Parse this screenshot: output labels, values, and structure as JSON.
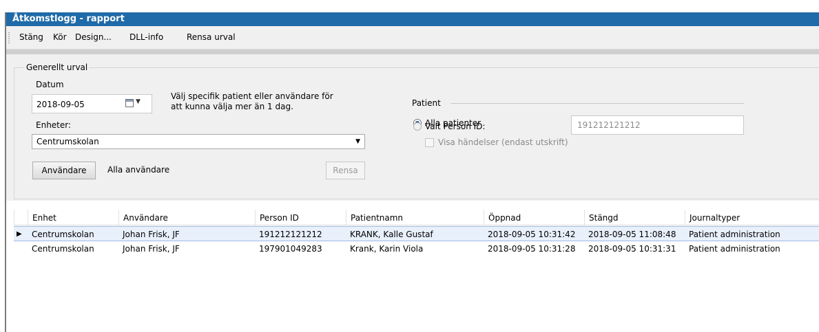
{
  "window": {
    "title": "Åtkomstlogg - rapport"
  },
  "menu": [
    {
      "label": "Stäng"
    },
    {
      "label": "Kör"
    },
    {
      "label": "Design..."
    },
    {
      "label": "DLL-info"
    },
    {
      "label": "Rensa urval"
    }
  ],
  "general": {
    "group_label": "Generellt urval",
    "date_label": "Datum",
    "date_value": "2018-09-05",
    "hint": [
      "Välj specifik patient eller användare för",
      "att kunna välja mer än 1 dag."
    ],
    "units_label": "Enheter:",
    "units_value": "Centrumskolan",
    "users_button": "Användare",
    "users_value": "Alla användare",
    "clear_button": "Rensa"
  },
  "patient": {
    "group_label": "Patient",
    "all_label": "Alla patienter",
    "all_selected": true,
    "selected_id_label": "Valt Person ID:",
    "person_id_value": "191212121212",
    "show_events_label": "Visa händelser (endast utskrift)",
    "show_events_checked": false
  },
  "table": {
    "columns": [
      "Enhet",
      "Användare",
      "Person ID",
      "Patientnamn",
      "Öppnad",
      "Stängd",
      "Journaltyper"
    ],
    "rows": [
      [
        "Centrumskolan",
        "Johan Frisk, JF",
        "191212121212",
        "KRANK, Kalle Gustaf",
        "2018-09-05 10:31:42",
        "2018-09-05 11:08:48",
        "Patient administration"
      ],
      [
        "Centrumskolan",
        "Johan Frisk, JF",
        "197901049283",
        "Krank, Karin Viola",
        "2018-09-05 10:31:28",
        "2018-09-05 10:31:31",
        "Patient administration"
      ]
    ],
    "selected_row": 0
  },
  "colors": {
    "titlebar": "#1f6aa8",
    "selection": "#e8f0fb",
    "panel": "#f0f0f0"
  }
}
